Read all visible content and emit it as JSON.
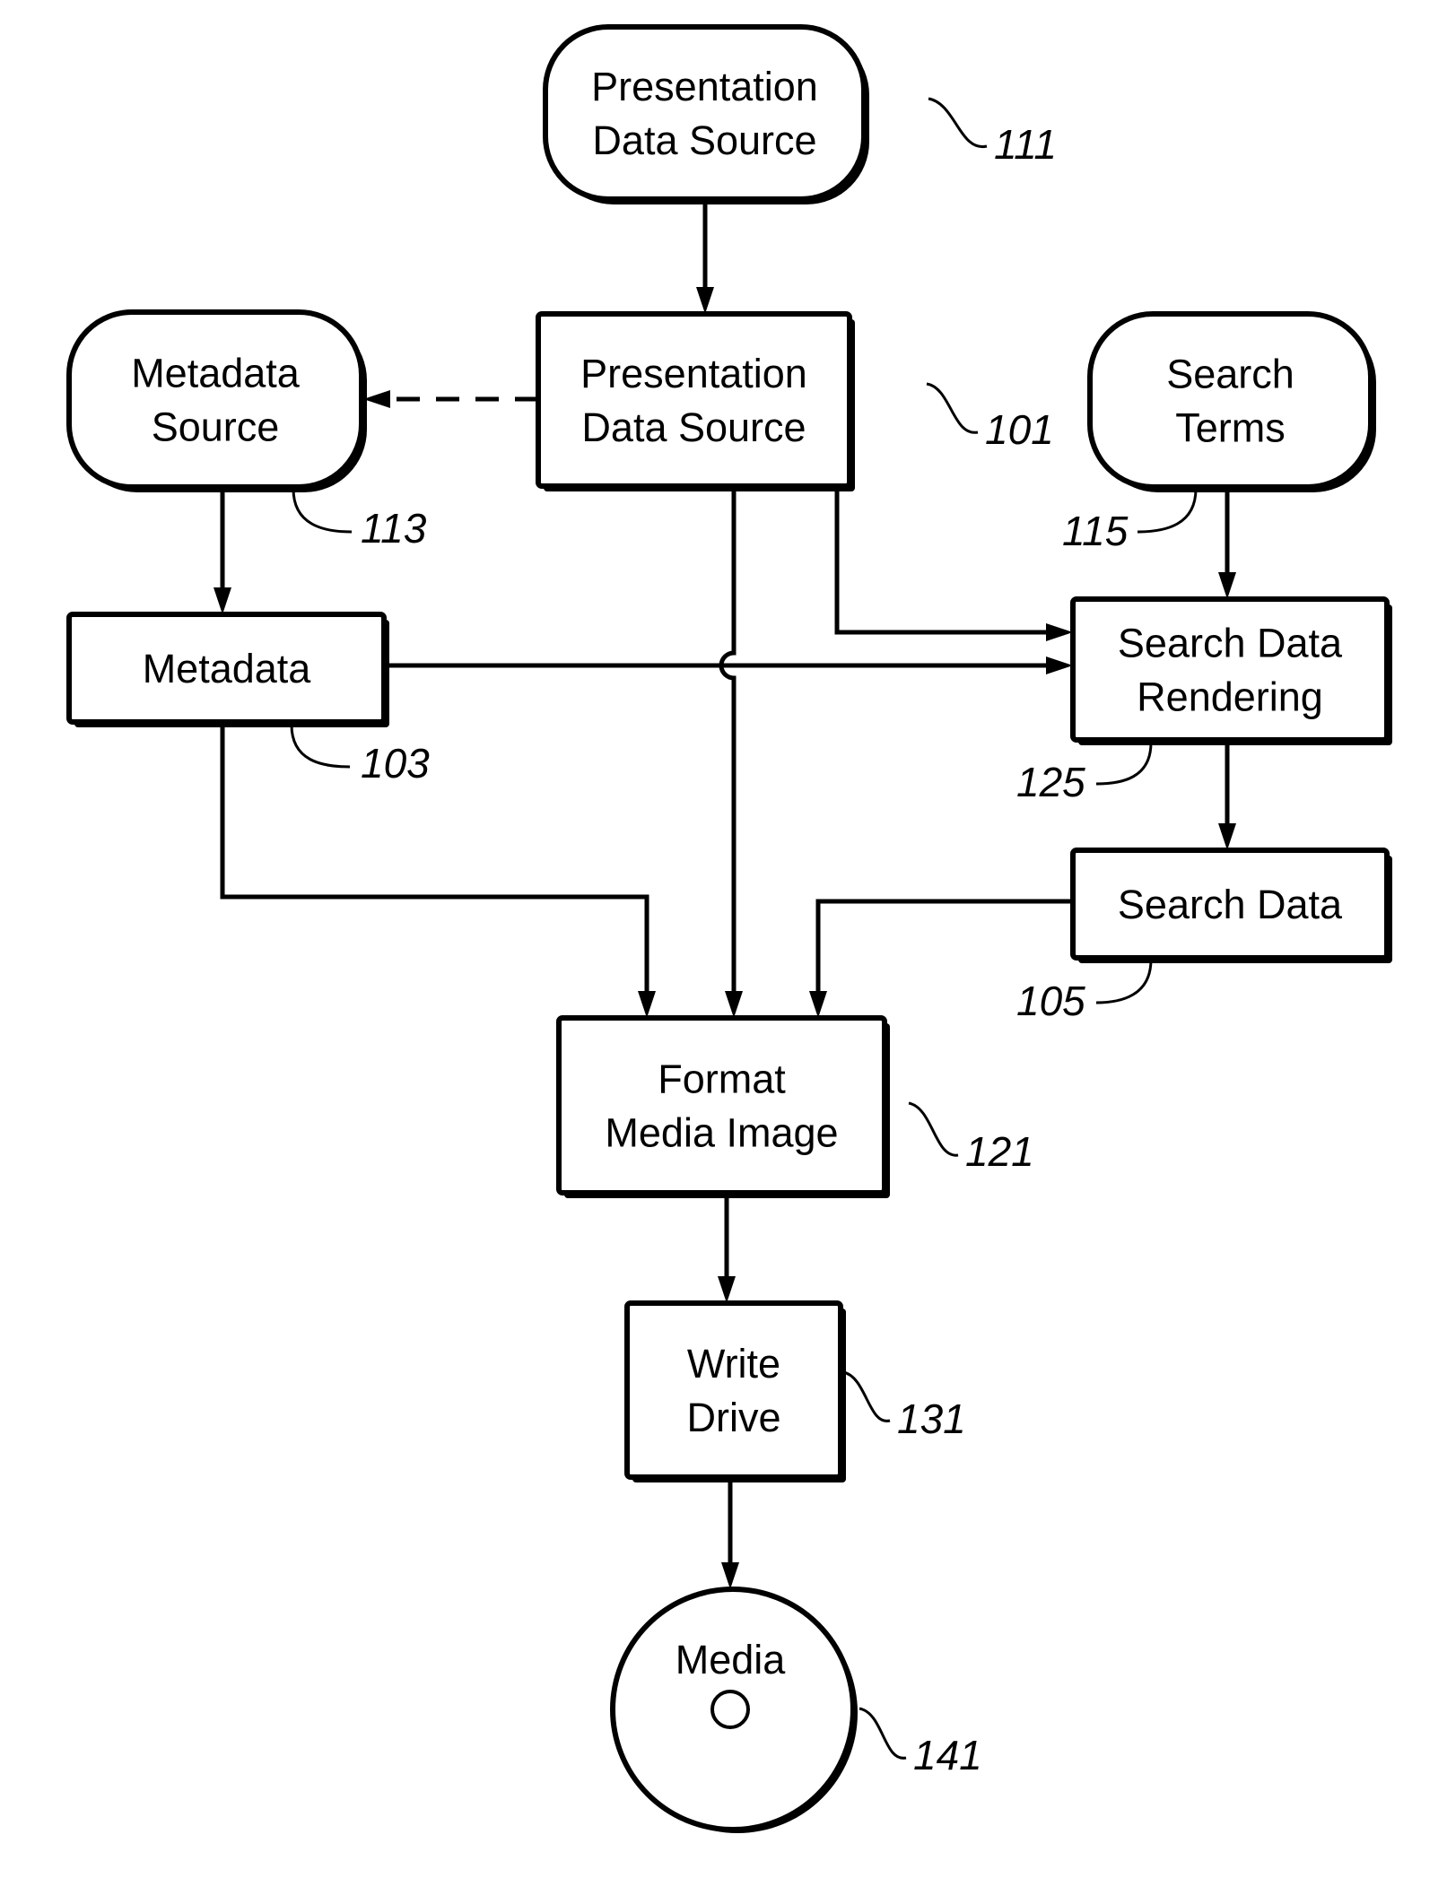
{
  "figure": {
    "nodes": [
      {
        "id": "n111",
        "shape": "rounded",
        "lines": [
          "Presentation",
          "Data Source"
        ],
        "ref": "111"
      },
      {
        "id": "n113",
        "shape": "rounded",
        "lines": [
          "Metadata",
          "Source"
        ],
        "ref": "113"
      },
      {
        "id": "n101",
        "shape": "rect",
        "lines": [
          "Presentation",
          "Data Source"
        ],
        "ref": "101"
      },
      {
        "id": "n115",
        "shape": "rounded",
        "lines": [
          "Search",
          "Terms"
        ],
        "ref": "115"
      },
      {
        "id": "n103",
        "shape": "rect",
        "lines": [
          "Metadata"
        ],
        "ref": "103"
      },
      {
        "id": "n125",
        "shape": "rect",
        "lines": [
          "Search Data",
          "Rendering"
        ],
        "ref": "125"
      },
      {
        "id": "n105",
        "shape": "rect",
        "lines": [
          "Search Data"
        ],
        "ref": "105"
      },
      {
        "id": "n121",
        "shape": "rect",
        "lines": [
          "Format",
          "Media Image"
        ],
        "ref": "121"
      },
      {
        "id": "n131",
        "shape": "rect",
        "lines": [
          "Write",
          "Drive"
        ],
        "ref": "131"
      },
      {
        "id": "n141",
        "shape": "disc",
        "lines": [
          "Media"
        ],
        "ref": "141"
      }
    ],
    "edges": [
      {
        "from": "n111",
        "to": "n101",
        "style": "solid"
      },
      {
        "from": "n101",
        "to": "n113",
        "style": "dashed"
      },
      {
        "from": "n113",
        "to": "n103",
        "style": "solid"
      },
      {
        "from": "n101",
        "to": "n125",
        "style": "solid"
      },
      {
        "from": "n103",
        "to": "n125",
        "style": "solid"
      },
      {
        "from": "n115",
        "to": "n125",
        "style": "solid"
      },
      {
        "from": "n125",
        "to": "n105",
        "style": "solid"
      },
      {
        "from": "n103",
        "to": "n121",
        "style": "solid"
      },
      {
        "from": "n101",
        "to": "n121",
        "style": "solid"
      },
      {
        "from": "n105",
        "to": "n121",
        "style": "solid"
      },
      {
        "from": "n121",
        "to": "n131",
        "style": "solid"
      },
      {
        "from": "n131",
        "to": "n141",
        "style": "solid"
      }
    ]
  }
}
